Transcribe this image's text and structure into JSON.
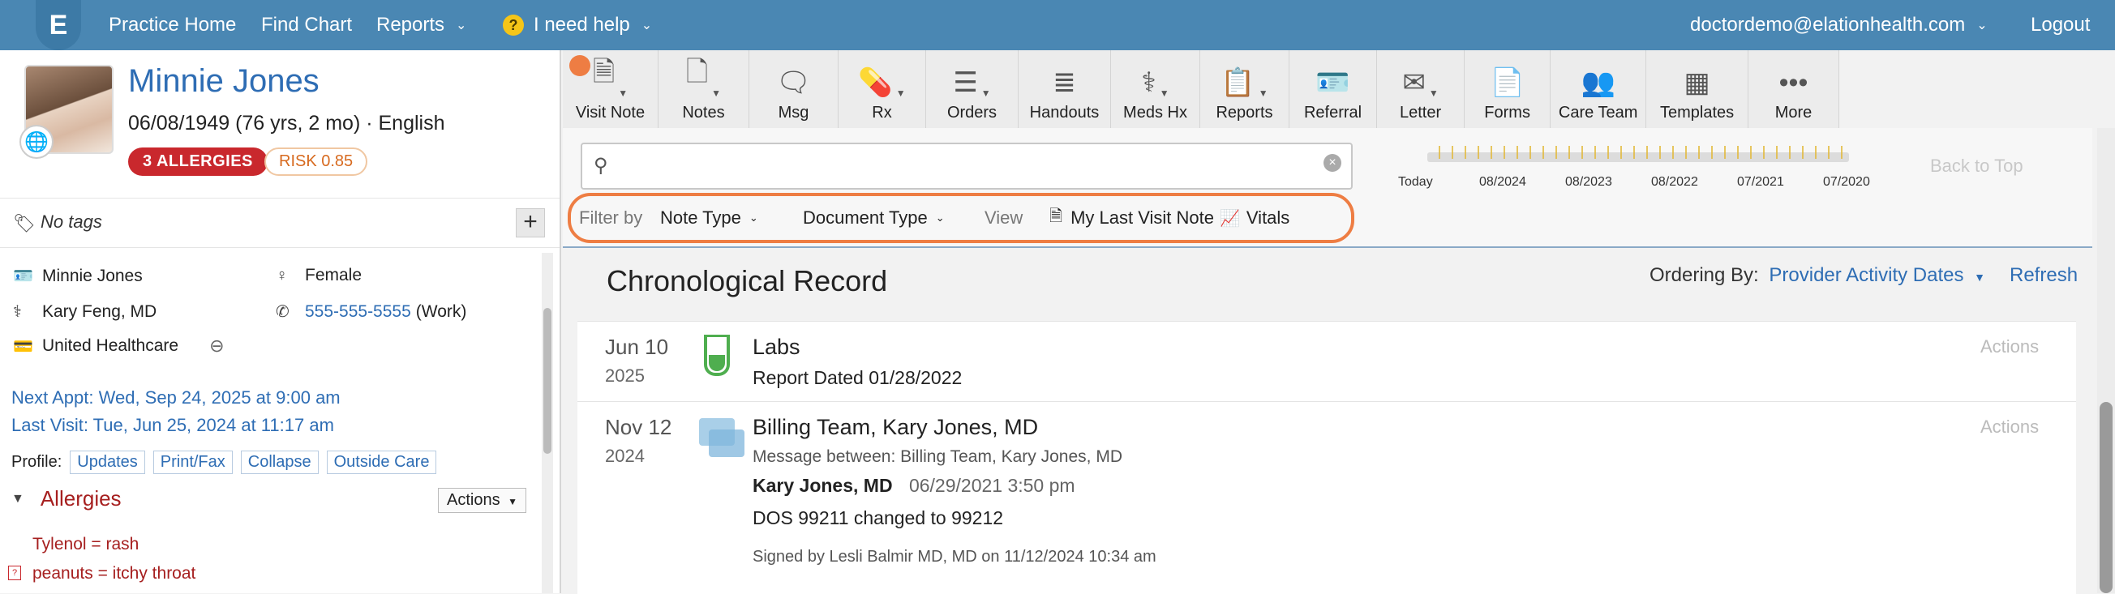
{
  "nav": {
    "logo": "E",
    "practice_home": "Practice Home",
    "find_chart": "Find Chart",
    "reports": "Reports",
    "help_icon": "?",
    "help": "I need help",
    "user_email": "doctordemo@elationhealth.com",
    "logout": "Logout"
  },
  "patient": {
    "name": "Minnie Jones",
    "dob_line": "06/08/1949 (76 yrs, 2 mo) · English",
    "allergies_badge": "3 ALLERGIES",
    "risk_badge": "RISK 0.85",
    "tags": "No tags",
    "add_tag": "+",
    "info_name": "Minnie Jones",
    "sex": "Female",
    "provider": "Kary Feng, MD",
    "phone": "555-555-5555",
    "phone_type": "(Work)",
    "insurance": "United Healthcare",
    "next_appt": "Next Appt: Wed, Sep 24, 2025 at 9:00 am",
    "last_visit": "Last Visit: Tue, Jun 25, 2024 at 11:17 am",
    "profile_label": "Profile:",
    "profile_buttons": [
      "Updates",
      "Print/Fax",
      "Collapse",
      "Outside Care"
    ],
    "allergies_heading": "Allergies",
    "actions": "Actions",
    "allergies": [
      "Tylenol = rash",
      "peanuts = itchy throat"
    ]
  },
  "toolbar": {
    "items": [
      {
        "label": "Visit Note",
        "icon": "visit-note-icon",
        "glyph": "🗎",
        "dropdown": true
      },
      {
        "label": "Notes",
        "icon": "notes-icon",
        "glyph": "🗋",
        "dropdown": true
      },
      {
        "label": "Msg",
        "icon": "message-icon",
        "glyph": "🗨",
        "dropdown": false
      },
      {
        "label": "Rx",
        "icon": "pill-icon",
        "glyph": "💊",
        "dropdown": true
      },
      {
        "label": "Orders",
        "icon": "orders-icon",
        "glyph": "☰",
        "dropdown": true
      },
      {
        "label": "Handouts",
        "icon": "handouts-icon",
        "glyph": "≣",
        "dropdown": false
      },
      {
        "label": "Meds Hx",
        "icon": "meds-hx-icon",
        "glyph": "⚕",
        "dropdown": true
      },
      {
        "label": "Reports",
        "icon": "reports-icon",
        "glyph": "📋",
        "dropdown": true
      },
      {
        "label": "Referral",
        "icon": "referral-icon",
        "glyph": "🪪",
        "dropdown": false
      },
      {
        "label": "Letter",
        "icon": "letter-icon",
        "glyph": "✉",
        "dropdown": true
      },
      {
        "label": "Forms",
        "icon": "forms-icon",
        "glyph": "📄",
        "dropdown": false
      },
      {
        "label": "Care Team",
        "icon": "care-team-icon",
        "glyph": "👥",
        "dropdown": false
      },
      {
        "label": "Templates",
        "icon": "templates-icon",
        "glyph": "▦",
        "dropdown": false
      },
      {
        "label": "More",
        "icon": "more-icon",
        "glyph": "•••",
        "dropdown": false
      }
    ]
  },
  "filters": {
    "search_placeholder": "",
    "timeline_labels": [
      "Today",
      "08/2024",
      "08/2023",
      "08/2022",
      "07/2021",
      "07/2020"
    ],
    "back_to_top": "Back to Top",
    "filter_by": "Filter by",
    "note_type": "Note Type",
    "document_type": "Document Type",
    "view": "View",
    "my_last_visit_note": "My Last Visit Note",
    "vitals": "Vitals"
  },
  "record": {
    "title": "Chronological Record",
    "ordering_label": "Ordering By:",
    "ordering_value": "Provider Activity Dates",
    "refresh": "Refresh",
    "entries": [
      {
        "date": "Jun 10",
        "year": "2025",
        "title": "Labs",
        "line1": "Report Dated 01/28/2022",
        "actions": "Actions"
      },
      {
        "date": "Nov 12",
        "year": "2024",
        "title": "Billing Team, Kary Jones, MD",
        "line1": "Message between: Billing Team, Kary Jones, MD",
        "author": "Kary Jones, MD",
        "author_time": "06/29/2021 3:50 pm",
        "body": "DOS 99211 changed to 99212",
        "signed": "Signed by Lesli Balmir MD, MD on 11/12/2024 10:34 am",
        "actions": "Actions"
      }
    ]
  },
  "colors": {
    "nav": "#4a87b3",
    "link": "#2e6db4",
    "allergy_red": "#c9282d",
    "highlight_orange": "#ee7d43"
  }
}
